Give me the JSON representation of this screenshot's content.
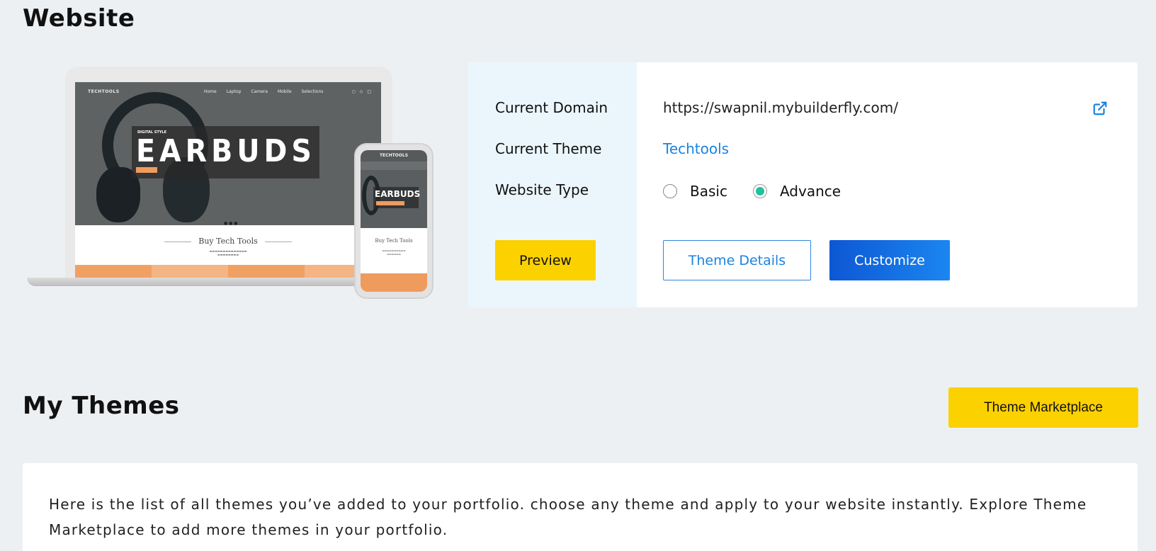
{
  "website": {
    "title": "Website",
    "mockup": {
      "brand": "TECHTOOLS",
      "nav_links": [
        "Home",
        "Laptop",
        "Camera",
        "Mobile",
        "Selections"
      ],
      "promo_small": "DIGITAL STYLE",
      "promo_big": "EARBUDS",
      "section_title": "Buy Tech Tools",
      "tile_colors": [
        "#f1a064",
        "#f4b483",
        "#f1a064",
        "#f4b483"
      ]
    },
    "labels": {
      "domain": "Current Domain",
      "theme": "Current Theme",
      "type": "Website Type"
    },
    "domain_value": "https://swapnil.mybuilderfly.com/",
    "theme_value": "Techtools",
    "type_options": [
      {
        "label": "Basic",
        "checked": false
      },
      {
        "label": "Advance",
        "checked": true
      }
    ],
    "buttons": {
      "preview": "Preview",
      "theme_details": "Theme Details",
      "customize": "Customize"
    },
    "icons": {
      "open_domain": "external-link-icon"
    },
    "colors": {
      "accent_blue": "#1a82e0",
      "yellow": "#fcd100",
      "radio_green": "#21c29a"
    }
  },
  "themes": {
    "title": "My Themes",
    "marketplace_button": "Theme Marketplace",
    "description": "Here is the list of all themes you’ve added to your portfolio. choose any theme and apply to your website instantly. Explore Theme Marketplace to add more themes in your portfolio."
  }
}
